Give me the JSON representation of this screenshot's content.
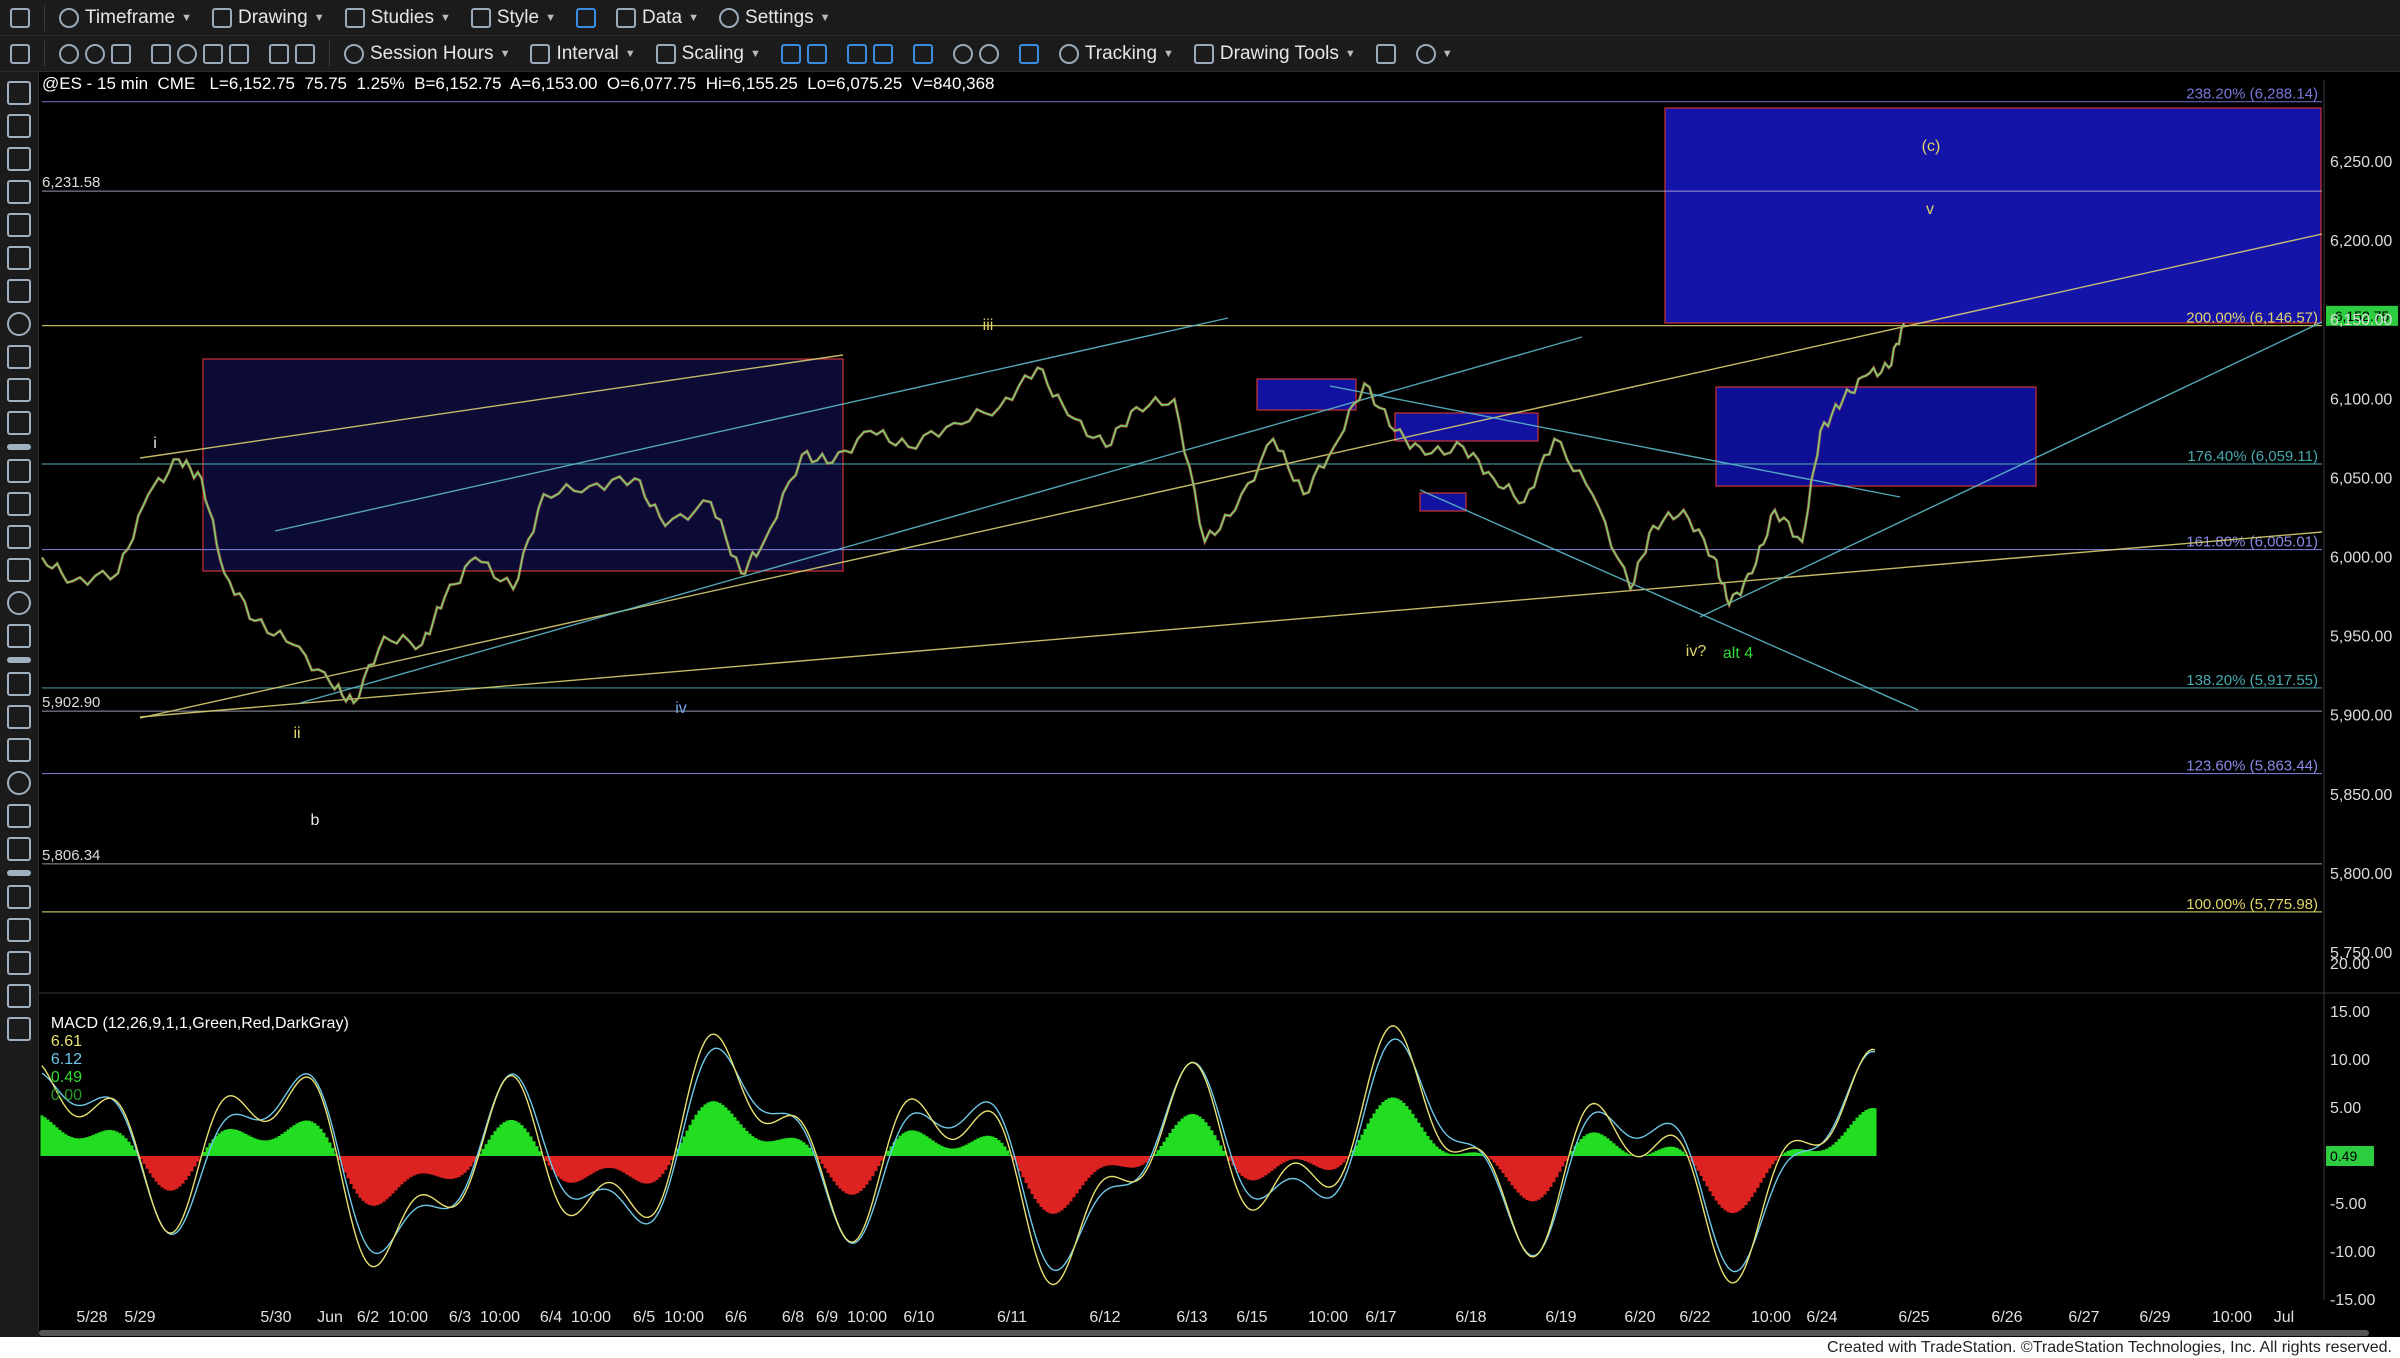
{
  "toolbar1": {
    "items": [
      {
        "label": "Timeframe",
        "icon": "clock-icon"
      },
      {
        "label": "Drawing",
        "icon": "pencil-icon"
      },
      {
        "label": "Studies",
        "icon": "flask-icon"
      },
      {
        "label": "Style",
        "icon": "style-icon"
      },
      {
        "label": "Data",
        "icon": "bar-chart-icon"
      },
      {
        "label": "Settings",
        "icon": "gear-icon"
      }
    ]
  },
  "toolbar2": {
    "items": [
      {
        "label": "Session Hours",
        "icon": "session-icon"
      },
      {
        "label": "Interval",
        "icon": "interval-icon"
      },
      {
        "label": "Scaling",
        "icon": "scaling-icon"
      },
      {
        "label": "Tracking",
        "icon": "tracking-icon"
      },
      {
        "label": "Drawing Tools",
        "icon": "drawing-tools-icon"
      }
    ]
  },
  "symbol_line": "@ES - 15 min  CME   L=6,152.75  75.75  1.25%  B=6,152.75  A=6,153.00  O=6,077.75  Hi=6,155.25  Lo=6,075.25  V=840,368",
  "macd": {
    "title": "MACD (12,26,9,1,1,Green,Red,DarkGray)",
    "values": [
      {
        "text": "6.61",
        "color": "#e8e070"
      },
      {
        "text": "6.12",
        "color": "#6ec8e8"
      },
      {
        "text": "0.49",
        "color": "#33dd33"
      },
      {
        "text": "0.00",
        "color": "#2a9a2a"
      }
    ],
    "current_label": "0.49",
    "axis_labels": [
      "20.00",
      "15.00",
      "10.00",
      "5.00",
      "-5.00",
      "-10.00",
      "-15.00"
    ]
  },
  "chart_data": {
    "type": "line",
    "symbol": "@ES",
    "interval": "15 min",
    "price_axis": [
      "6,250.00",
      "6,200.00",
      "6,150.00",
      "6,100.00",
      "6,050.00",
      "6,000.00",
      "5,950.00",
      "5,900.00",
      "5,850.00",
      "5,800.00",
      "5,750.00"
    ],
    "current_price_label": "6,152.75",
    "left_levels": [
      {
        "label": "6,231.58",
        "value": 6231.58
      },
      {
        "label": "5,902.90",
        "value": 5902.9
      },
      {
        "label": "5,806.34",
        "value": 5806.34
      }
    ],
    "fib_levels": [
      {
        "label": "238.20% (6,288.14)",
        "value": 6288.14,
        "color": "#7a78d8"
      },
      {
        "label": "200.00% (6,146.57)",
        "value": 6146.57,
        "color": "#e0d56a"
      },
      {
        "label": "176.40% (6,059.11)",
        "value": 6059.11,
        "color": "#4aa8b0"
      },
      {
        "label": "161.80% (6,005.01)",
        "value": 6005.01,
        "color": "#8a8ae8"
      },
      {
        "label": "138.20% (5,917.55)",
        "value": 5917.55,
        "color": "#4aa8b0"
      },
      {
        "label": "123.60% (5,863.44)",
        "value": 5863.44,
        "color": "#8a8ae8"
      },
      {
        "label": "100.00% (5,775.98)",
        "value": 5775.98,
        "color": "#e0d56a"
      }
    ],
    "x_labels": [
      "5/28",
      "5/29",
      "5/30",
      "Jun",
      "6/2",
      "10:00",
      "6/3",
      "10:00",
      "6/4",
      "10:00",
      "6/5",
      "10:00",
      "6/6",
      "6/8",
      "6/9",
      "10:00",
      "6/10",
      "6/11",
      "6/12",
      "6/13",
      "6/15",
      "10:00",
      "6/17",
      "6/18",
      "6/19",
      "6/20",
      "6/22",
      "10:00",
      "6/24",
      "6/25",
      "6/26",
      "6/27",
      "6/29",
      "10:00",
      "Jul"
    ],
    "price_path": [
      [
        0,
        6000
      ],
      [
        20,
        5985
      ],
      [
        50,
        5990
      ],
      [
        70,
        6040
      ],
      [
        90,
        6062
      ],
      [
        105,
        6050
      ],
      [
        120,
        5990
      ],
      [
        140,
        5960
      ],
      [
        165,
        5945
      ],
      [
        190,
        5920
      ],
      [
        205,
        5908
      ],
      [
        225,
        5950
      ],
      [
        250,
        5945
      ],
      [
        265,
        5975
      ],
      [
        285,
        6000
      ],
      [
        310,
        5980
      ],
      [
        330,
        6040
      ],
      [
        360,
        6045
      ],
      [
        390,
        6050
      ],
      [
        410,
        6020
      ],
      [
        440,
        6035
      ],
      [
        460,
        5990
      ],
      [
        475,
        6010
      ],
      [
        500,
        6065
      ],
      [
        520,
        6060
      ],
      [
        545,
        6080
      ],
      [
        570,
        6070
      ],
      [
        600,
        6085
      ],
      [
        630,
        6095
      ],
      [
        655,
        6120
      ],
      [
        675,
        6090
      ],
      [
        700,
        6070
      ],
      [
        720,
        6095
      ],
      [
        745,
        6100
      ],
      [
        765,
        6010
      ],
      [
        785,
        6030
      ],
      [
        810,
        6075
      ],
      [
        830,
        6040
      ],
      [
        850,
        6070
      ],
      [
        870,
        6110
      ],
      [
        890,
        6080
      ],
      [
        910,
        6065
      ],
      [
        935,
        6070
      ],
      [
        955,
        6050
      ],
      [
        975,
        6035
      ],
      [
        995,
        6075
      ],
      [
        1020,
        6040
      ],
      [
        1045,
        5980
      ],
      [
        1060,
        6020
      ],
      [
        1080,
        6030
      ],
      [
        1100,
        6000
      ],
      [
        1110,
        5970
      ],
      [
        1125,
        5990
      ],
      [
        1140,
        6030
      ],
      [
        1158,
        6010
      ],
      [
        1170,
        6080
      ],
      [
        1185,
        6100
      ],
      [
        1200,
        6115
      ],
      [
        1215,
        6120
      ],
      [
        1225,
        6148
      ]
    ],
    "wave_labels": [
      "i",
      "ii",
      "b",
      "iii",
      "iv",
      "iv?",
      "alt 4",
      "(c)",
      "v"
    ]
  },
  "footer": "Created with TradeStation. ©TradeStation Technologies, Inc. All rights reserved."
}
